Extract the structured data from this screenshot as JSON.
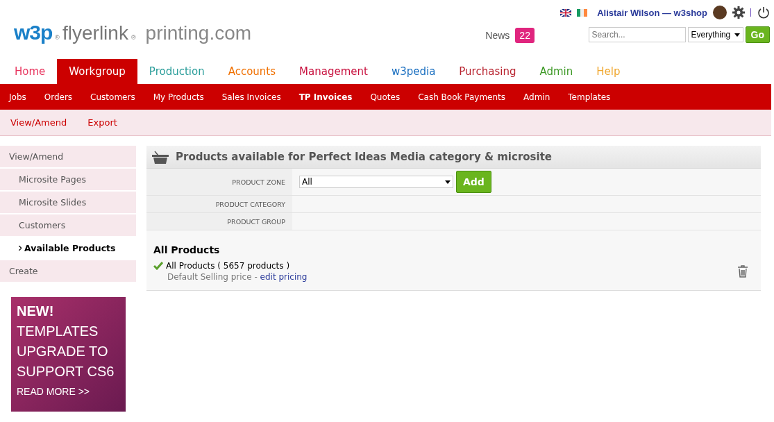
{
  "logo": {
    "mark": "w3p",
    "mark_sup": "®",
    "brand": "flyerlink",
    "brand_sup": "®",
    "site": "printing.com"
  },
  "user": {
    "name": "Alistair Wilson — w3shop"
  },
  "news": {
    "label": "News",
    "count": "22"
  },
  "search": {
    "placeholder": "Search...",
    "scope": "Everything",
    "button": "Go"
  },
  "main_tabs": [
    {
      "label": "Home",
      "selected": false,
      "color": "#e8365f"
    },
    {
      "label": "Workgroup",
      "selected": true,
      "color": "#cc0000"
    },
    {
      "label": "Production",
      "selected": false,
      "color": "#2a9d9a"
    },
    {
      "label": "Accounts",
      "selected": false,
      "color": "#f07000"
    },
    {
      "label": "Management",
      "selected": false,
      "color": "#c8103e"
    },
    {
      "label": "w3pedia",
      "selected": false,
      "color": "#1a6fc0"
    },
    {
      "label": "Purchasing",
      "selected": false,
      "color": "#b8232f"
    },
    {
      "label": "Admin",
      "selected": false,
      "color": "#3f9a28"
    },
    {
      "label": "Help",
      "selected": false,
      "color": "#f0a830"
    }
  ],
  "sub_tabs": [
    {
      "label": "Jobs",
      "selected": false
    },
    {
      "label": "Orders",
      "selected": false
    },
    {
      "label": "Customers",
      "selected": false
    },
    {
      "label": "My Products",
      "selected": false
    },
    {
      "label": "Sales Invoices",
      "selected": false
    },
    {
      "label": "TP Invoices",
      "selected": true
    },
    {
      "label": "Quotes",
      "selected": false
    },
    {
      "label": "Cash Book Payments",
      "selected": false
    },
    {
      "label": "Admin",
      "selected": false
    },
    {
      "label": "Templates",
      "selected": false
    }
  ],
  "actions": [
    "View/Amend",
    "Export"
  ],
  "sidebar": {
    "items": [
      {
        "label": "View/Amend",
        "selected": false,
        "children": [
          {
            "label": "Microsite Pages",
            "selected": false
          },
          {
            "label": "Microsite Slides",
            "selected": false
          },
          {
            "label": "Customers",
            "selected": false
          },
          {
            "label": "Available Products",
            "selected": true
          }
        ]
      },
      {
        "label": "Create",
        "selected": false
      }
    ]
  },
  "promo": {
    "lines": [
      "NEW!",
      "TEMPLATES",
      "UPGRADE TO",
      "SUPPORT CS6"
    ],
    "link": "READ MORE >>"
  },
  "panel": {
    "title": "Products available for Perfect Ideas Media category & microsite",
    "fields": [
      {
        "label": "PRODUCT ZONE",
        "kind": "select",
        "value": "All",
        "button": "Add"
      },
      {
        "label": "PRODUCT CATEGORY",
        "kind": "empty"
      },
      {
        "label": "PRODUCT GROUP",
        "kind": "empty"
      }
    ],
    "section_title": "All Products",
    "products": [
      {
        "name": "All Products ( 5657 products )",
        "price": "Default Selling price -",
        "link": "edit pricing",
        "checked": true
      }
    ]
  }
}
